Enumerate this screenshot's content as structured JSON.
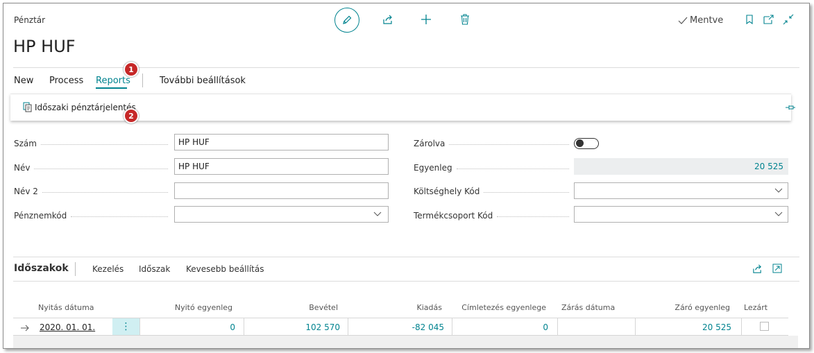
{
  "header": {
    "caption": "Pénztár",
    "title": "HP HUF",
    "saved_label": "Mentve"
  },
  "menu": {
    "new": "New",
    "process": "Process",
    "reports": "Reports",
    "more": "További beállítások"
  },
  "report_action": "Időszaki pénztárjelentés",
  "badges": {
    "one": "1",
    "two": "2"
  },
  "fields": {
    "szam": {
      "label": "Szám",
      "value": "HP HUF"
    },
    "nev": {
      "label": "Név",
      "value": "HP HUF"
    },
    "nev2": {
      "label": "Név 2",
      "value": ""
    },
    "penznem": {
      "label": "Pénznemkód",
      "value": ""
    },
    "zarolva": {
      "label": "Zárolva"
    },
    "egyenleg": {
      "label": "Egyenleg",
      "value": "20 525"
    },
    "koltseghely": {
      "label": "Költséghely Kód",
      "value": ""
    },
    "termekcsoport": {
      "label": "Termékcsoport Kód",
      "value": ""
    }
  },
  "section": {
    "title": "Időszakok",
    "kezeles": "Kezelés",
    "idoszak": "Időszak",
    "kevesebb": "Kevesebb beállítás"
  },
  "table": {
    "headers": {
      "nyitas": "Nyitás dátuma",
      "nyito": "Nyitó egyenleg",
      "bevetel": "Bevétel",
      "kiadas": "Kiadás",
      "cimletezes": "Címletezés egyenlege",
      "zaras": "Zárás dátuma",
      "zaro": "Záró egyenleg",
      "lezart": "Lezárt"
    },
    "row": {
      "nyitas": "2020. 01. 01.",
      "nyito": "0",
      "bevetel": "102 570",
      "kiadas": "-82 045",
      "cimletezes": "0",
      "zaras": "",
      "zaro": "20 525",
      "menu_dots": "⋮"
    }
  },
  "colors": {
    "accent": "#00838f",
    "badge": "#c62828"
  }
}
